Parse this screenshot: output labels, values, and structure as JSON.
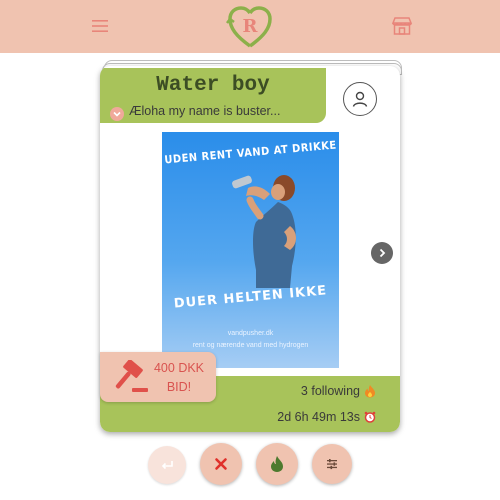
{
  "header": {
    "logo_letter": "R"
  },
  "listing": {
    "title": "Water boy",
    "description": "Æloha my name is buster...",
    "poster": {
      "top_text": "UDEN RENT VAND AT DRIKKE",
      "headline": "DUER HELTEN IKKE",
      "url": "vandpusher.dk",
      "tagline": "rent og nærende vand med hydrogen"
    },
    "following": "3 following",
    "time_left": "2d 6h 49m 13s"
  },
  "bid": {
    "amount": "400 DKK",
    "label": "BID!"
  },
  "colors": {
    "header_bg": "#f0c3b0",
    "accent_green": "#a8c35a",
    "accent_red": "#d9534f",
    "dark_green": "#5a7a3a"
  }
}
